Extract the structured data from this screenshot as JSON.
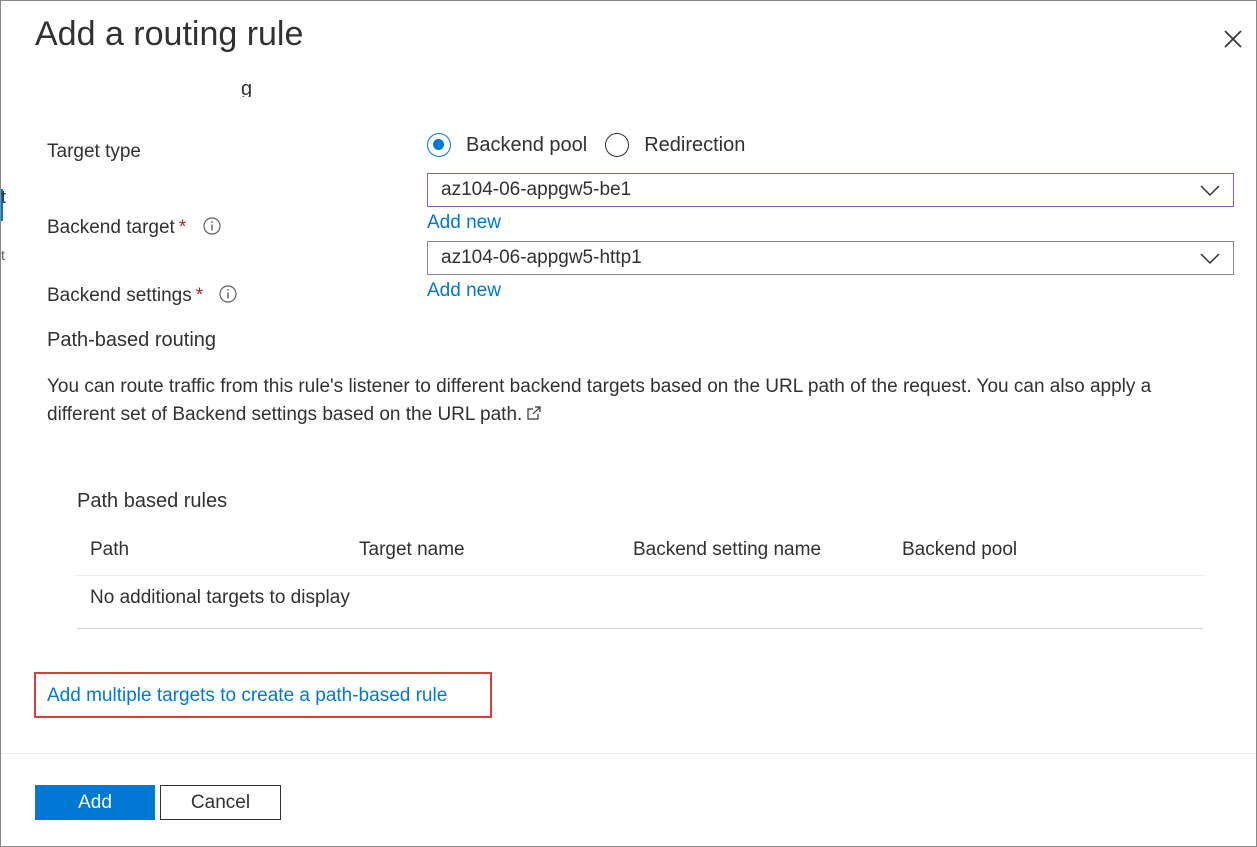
{
  "panel": {
    "title": "Add a routing rule",
    "close_icon": "close-icon",
    "left_strip_char": "t",
    "left_strip_char2": "t",
    "cut_text": "g"
  },
  "form": {
    "target_type": {
      "label": "Target type",
      "options": [
        {
          "label": "Backend pool",
          "checked": true
        },
        {
          "label": "Redirection",
          "checked": false
        }
      ]
    },
    "backend_target": {
      "label": "Backend target",
      "required_mark": "*",
      "value": "az104-06-appgw5-be1",
      "add_new": "Add new"
    },
    "backend_settings": {
      "label": "Backend settings",
      "required_mark": "*",
      "value": "az104-06-appgw5-http1",
      "add_new": "Add new"
    }
  },
  "path_routing": {
    "title": "Path-based routing",
    "description": "You can route traffic from this rule's listener to different backend targets based on the URL path of the request. You can also apply a different set of Backend settings based on the URL path."
  },
  "rules_table": {
    "title": "Path based rules",
    "columns": [
      "Path",
      "Target name",
      "Backend setting name",
      "Backend pool"
    ],
    "empty_message": "No additional targets to display"
  },
  "add_multiple_link": "Add multiple targets to create a path-based rule",
  "footer": {
    "add_label": "Add",
    "cancel_label": "Cancel"
  },
  "colors": {
    "accent": "#0078d4",
    "required": "#a4262c",
    "highlight": "#e03c3c",
    "focus_border": "#8661c5"
  }
}
